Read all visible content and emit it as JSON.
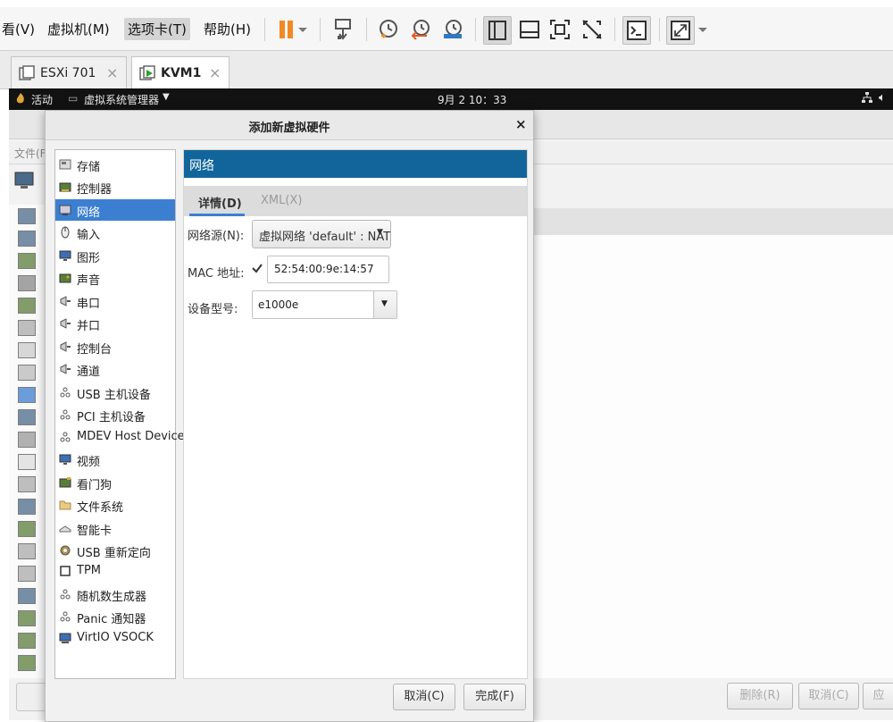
{
  "menu": {
    "items": [
      "看(V)",
      "虚拟机(M)",
      "选项卡(T)",
      "帮助(H)"
    ],
    "active_index": 2
  },
  "toolbar": {
    "icons": [
      "pause-icon",
      "dropdown-arrow-icon",
      "send-ctrl-alt-del-icon",
      "snapshot-icon",
      "revert-snapshot-icon",
      "snapshot-manager-icon",
      "single-window-icon",
      "console-view-icon",
      "fullscreen-icon",
      "unity-icon",
      "terminal-icon",
      "stretch-icon",
      "dropdown-arrow-icon"
    ]
  },
  "vm_tabs": [
    {
      "label": "ESXi 701",
      "active": false
    },
    {
      "label": "KVM1",
      "active": true
    }
  ],
  "guest_bar": {
    "activities": "活动",
    "app_menu": "虚拟系统管理器",
    "clock": "9月 2 10：33"
  },
  "background_window": {
    "file_menu_partial": "文件(F",
    "buttons": [
      "删除(R)",
      "取消(C)",
      "应"
    ]
  },
  "dialog": {
    "title": "添加新虚拟硬件",
    "close": "×",
    "hardware_list": [
      {
        "label": "存储",
        "icon": "disk-icon"
      },
      {
        "label": "控制器",
        "icon": "controller-icon"
      },
      {
        "label": "网络",
        "icon": "network-icon",
        "selected": true
      },
      {
        "label": "输入",
        "icon": "mouse-icon"
      },
      {
        "label": "图形",
        "icon": "display-icon"
      },
      {
        "label": "声音",
        "icon": "sound-card-icon"
      },
      {
        "label": "串口",
        "icon": "serial-port-icon"
      },
      {
        "label": "并口",
        "icon": "parallel-port-icon"
      },
      {
        "label": "控制台",
        "icon": "console-icon"
      },
      {
        "label": "通道",
        "icon": "channel-icon"
      },
      {
        "label": "USB 主机设备",
        "icon": "usb-device-icon"
      },
      {
        "label": "PCI 主机设备",
        "icon": "pci-device-icon"
      },
      {
        "label": "MDEV Host Device",
        "icon": "mdev-device-icon"
      },
      {
        "label": "视频",
        "icon": "video-icon"
      },
      {
        "label": "看门狗",
        "icon": "watchdog-icon"
      },
      {
        "label": "文件系统",
        "icon": "folder-icon"
      },
      {
        "label": "智能卡",
        "icon": "smartcard-icon"
      },
      {
        "label": "USB 重新定向",
        "icon": "usb-redirect-icon"
      },
      {
        "label": "TPM",
        "icon": "tpm-icon"
      },
      {
        "label": "随机数生成器",
        "icon": "rng-icon"
      },
      {
        "label": "Panic 通知器",
        "icon": "panic-notifier-icon"
      },
      {
        "label": "VirtIO VSOCK",
        "icon": "vsock-icon"
      }
    ],
    "section_title": "网络",
    "tabs": [
      {
        "label": "详情(D)",
        "active": true
      },
      {
        "label": "XML(X)",
        "active": false
      }
    ],
    "form": {
      "network_source_label": "网络源(N):",
      "network_source_value": "虚拟网络 'default' : NAT",
      "mac_label": "MAC 地址:",
      "mac_checked": true,
      "mac_value": "52:54:00:9e:14:57",
      "device_model_label": "设备型号:",
      "device_model_value": "e1000e"
    },
    "buttons": {
      "cancel": "取消(C)",
      "finish": "完成(F)"
    }
  },
  "colors": {
    "selection": "#3c7fd0",
    "section_header": "#11659b",
    "pause_orange": "#f08a24"
  }
}
